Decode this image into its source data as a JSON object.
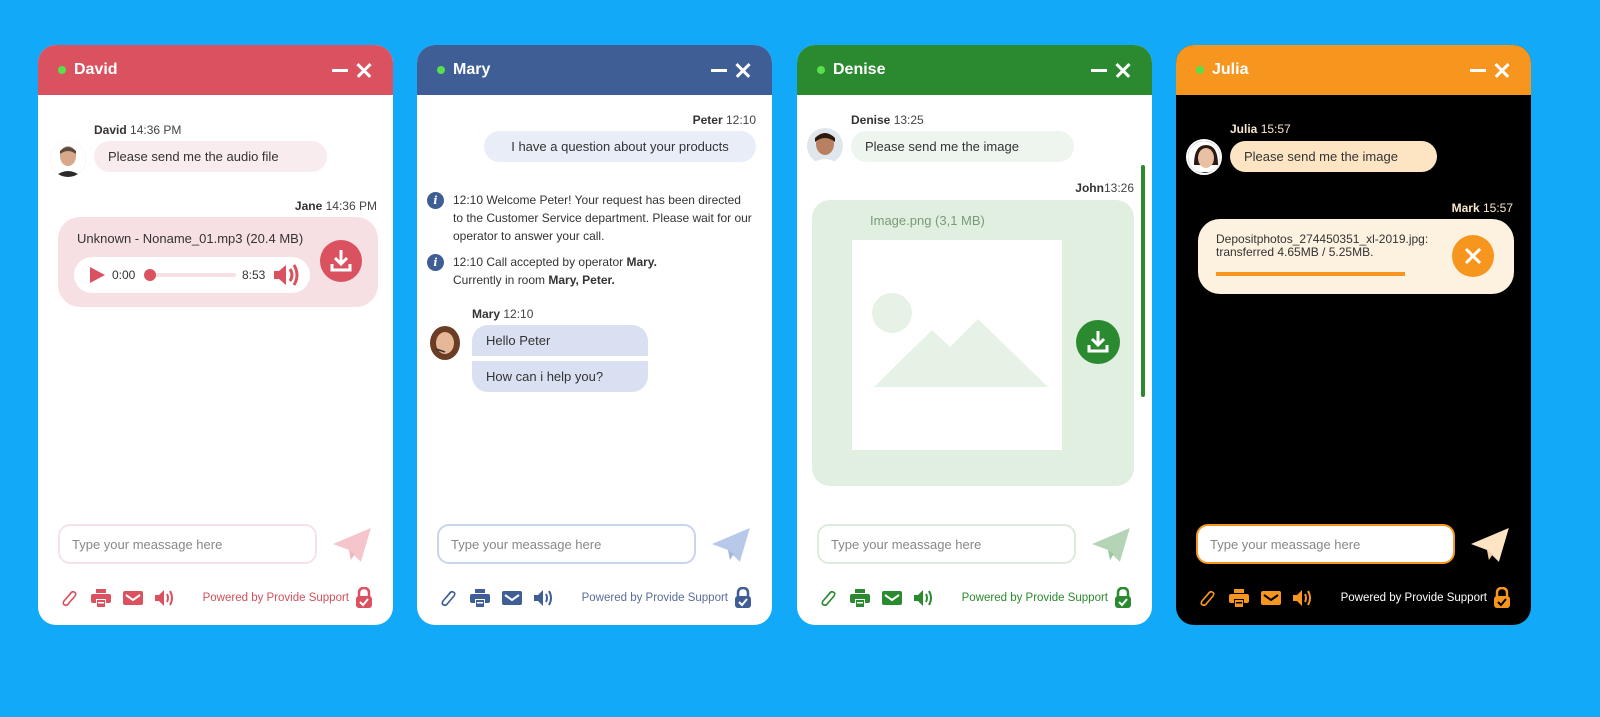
{
  "widgets": {
    "david": {
      "title": "David",
      "accent": "#da525f",
      "messages": {
        "m1_sender": "David",
        "m1_time": "14:36 PM",
        "m1_text": "Please send me the audio file",
        "m2_sender": "Jane",
        "m2_time": "14:36 PM",
        "file_name": "Unknown - Noname_01.mp3 (20.4 MB)",
        "audio_current": "0:00",
        "audio_total": "8:53",
        "audio_progress": 0
      },
      "input_placeholder": "Type your meassage here",
      "powered_by": "Powered by Provide Support"
    },
    "mary": {
      "title": "Mary",
      "accent": "#3f5e96",
      "messages": {
        "m1_sender": "Peter",
        "m1_time": "12:10",
        "m1_text": "I have a question about your products",
        "info1": "12:10 Welcome Peter! Your request has been directed to the Customer Service department. Please wait for our operator to answer your call.",
        "info2_prefix": "12:10 Call accepted by operator ",
        "info2_operator": "Mary.",
        "info2_room_prefix": "Currently in room ",
        "info2_room": "Mary, Peter.",
        "m2_sender": "Mary",
        "m2_time": "12:10",
        "m2_text1": "Hello Peter",
        "m2_text2": "How can i help you?"
      },
      "input_placeholder": "Type your meassage here",
      "powered_by": "Powered by Provide Support"
    },
    "denise": {
      "title": "Denise",
      "accent": "#2b8a2f",
      "messages": {
        "m1_sender": "Denise",
        "m1_time": "13:25",
        "m1_text": "Please send me the image",
        "m2_sender": "John",
        "m2_time": "13:26",
        "file_name": "Image.png (3,1 MB)"
      },
      "input_placeholder": "Type your meassage here",
      "powered_by": "Powered by Provide Support"
    },
    "julia": {
      "title": "Julia",
      "accent": "#f7961e",
      "messages": {
        "m1_sender": "Julia",
        "m1_time": "15:57",
        "m1_text": "Please send me the image",
        "m2_sender": "Mark",
        "m2_time": "15:57",
        "file_name": "Depositphotos_274450351_xl-2019.jpg:",
        "transfer_status": "transferred 4.65MB / 5.25MB.",
        "transfer_progress": 0.886
      },
      "input_placeholder": "Type your meassage here",
      "powered_by": "Powered by Provide Support"
    }
  }
}
